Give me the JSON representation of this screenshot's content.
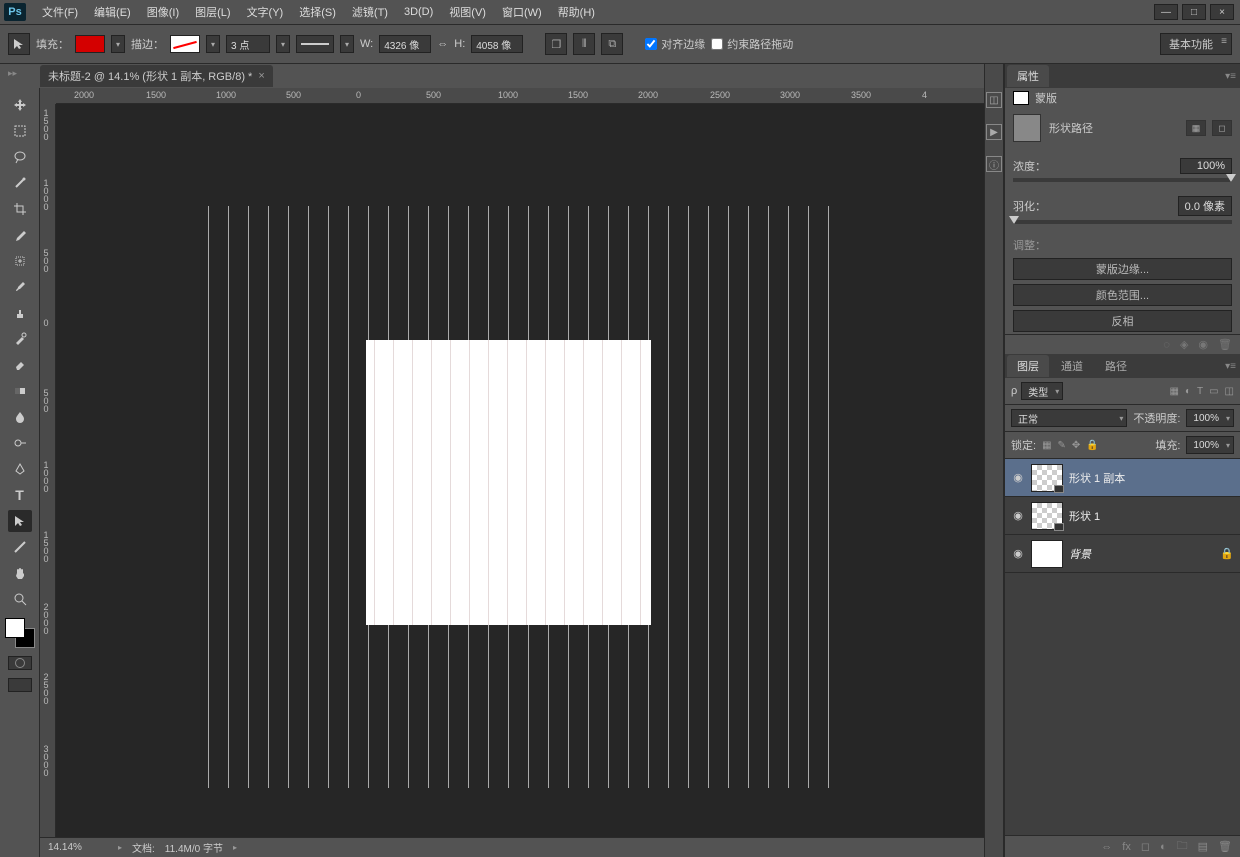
{
  "app": {
    "logo_text": "Ps"
  },
  "menu": {
    "file": "文件(F)",
    "edit": "编辑(E)",
    "image": "图像(I)",
    "layer": "图层(L)",
    "type": "文字(Y)",
    "select": "选择(S)",
    "filter": "滤镜(T)",
    "threeD": "3D(D)",
    "view": "视图(V)",
    "window": "窗口(W)",
    "help": "帮助(H)"
  },
  "window_controls": {
    "min": "—",
    "max": "□",
    "close": "×"
  },
  "options_bar": {
    "fill_label": "填充：",
    "stroke_label": "描边：",
    "stroke_size": "3 点",
    "w_label": "W:",
    "w_value": "4326 像",
    "link_chain": "⇔",
    "h_label": "H:",
    "h_value": "4058 像",
    "align_edges_label": "对齐边缘",
    "constrain_path_label": "约束路径拖动",
    "workspace": "基本功能"
  },
  "doc_tab": {
    "title": "未标题-2 @ 14.1% (形状 1 副本, RGB/8) *",
    "close": "×"
  },
  "ruler_h_labels": [
    "2000",
    "1500",
    "1000",
    "500",
    "0",
    "500",
    "1000",
    "1500",
    "2000",
    "2500",
    "3000",
    "3500",
    "4"
  ],
  "ruler_v_labels": [
    "1500",
    "1000",
    "500",
    "0",
    "500",
    "1000",
    "1500",
    "2000",
    "2500",
    "3000"
  ],
  "status": {
    "zoom": "14.14%",
    "doc_info_label": "文档:",
    "doc_info": "11.4M/0 字节"
  },
  "panel_props": {
    "tab": "属性",
    "mask_label": "蒙版",
    "shape_path": "形状路径",
    "density_label": "浓度：",
    "density_value": "100%",
    "feather_label": "羽化：",
    "feather_value": "0.0 像素",
    "adjust_label": "调整：",
    "btn_mask_edges": "蒙版边缘...",
    "btn_color_range": "颜色范围...",
    "btn_invert": "反相"
  },
  "panel_layers": {
    "tab_layers": "图层",
    "tab_channels": "通道",
    "tab_paths": "路径",
    "filter_kind": "类型",
    "blend_mode": "正常",
    "opacity_label": "不透明度:",
    "opacity_value": "100%",
    "lock_label": "锁定:",
    "fill_label": "填充:",
    "fill_value": "100%",
    "layers": [
      {
        "name": "形状 1 副本",
        "selected": true,
        "checker": true,
        "italic": false,
        "lock": false
      },
      {
        "name": "形状 1",
        "selected": false,
        "checker": true,
        "italic": false,
        "lock": false
      },
      {
        "name": "背景",
        "selected": false,
        "checker": false,
        "italic": true,
        "lock": true
      }
    ]
  }
}
